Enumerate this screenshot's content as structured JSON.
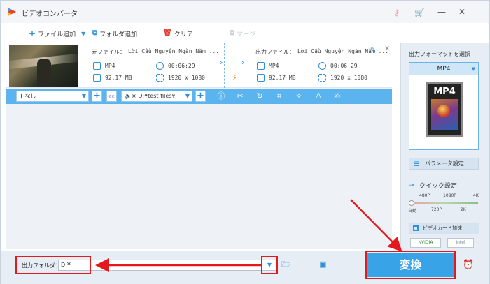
{
  "window": {
    "title": "ビデオコンバータ"
  },
  "toolbar": {
    "add_file": "ファイル追加",
    "add_folder": "フォルダ追加",
    "clear": "クリア",
    "merge": "マージ"
  },
  "file_item": {
    "source_label": "元ファイル：",
    "source_name": "Lời Cầu Nguyện Ngàn Năm ...",
    "output_label": "出力ファイル：",
    "output_name": "Lời Cầu Nguyện Ngàn Năm ...",
    "src_format": "MP4",
    "src_duration": "00:06:29",
    "src_size": "92.17 MB",
    "src_resolution": "1920 x 1080",
    "out_format": "MP4",
    "out_duration": "00:06:29",
    "out_size": "92.17 MB",
    "out_resolution": "1920 x 1080"
  },
  "editbar": {
    "subtitle_select": "なし",
    "audio_track_select": "D:¥test files¥"
  },
  "right_panel": {
    "title": "出力フォーマットを選択",
    "format": "MP4",
    "format_icon_label": "MP4",
    "params_button": "パラメータ設定",
    "quick_settings": "クイック設定",
    "quality_top": [
      "480P",
      "1080P",
      "4K"
    ],
    "quality_bottom": [
      "自動",
      "720P",
      "2K"
    ],
    "gpu_accel": "ビデオカード加速",
    "gpu_chips": [
      "NVIDIA",
      "Intel"
    ]
  },
  "bottom": {
    "output_folder_label": "出力フォルダ：",
    "output_path": "D:¥",
    "convert_button": "変換"
  },
  "annotations": {
    "color": "#e3191e"
  }
}
